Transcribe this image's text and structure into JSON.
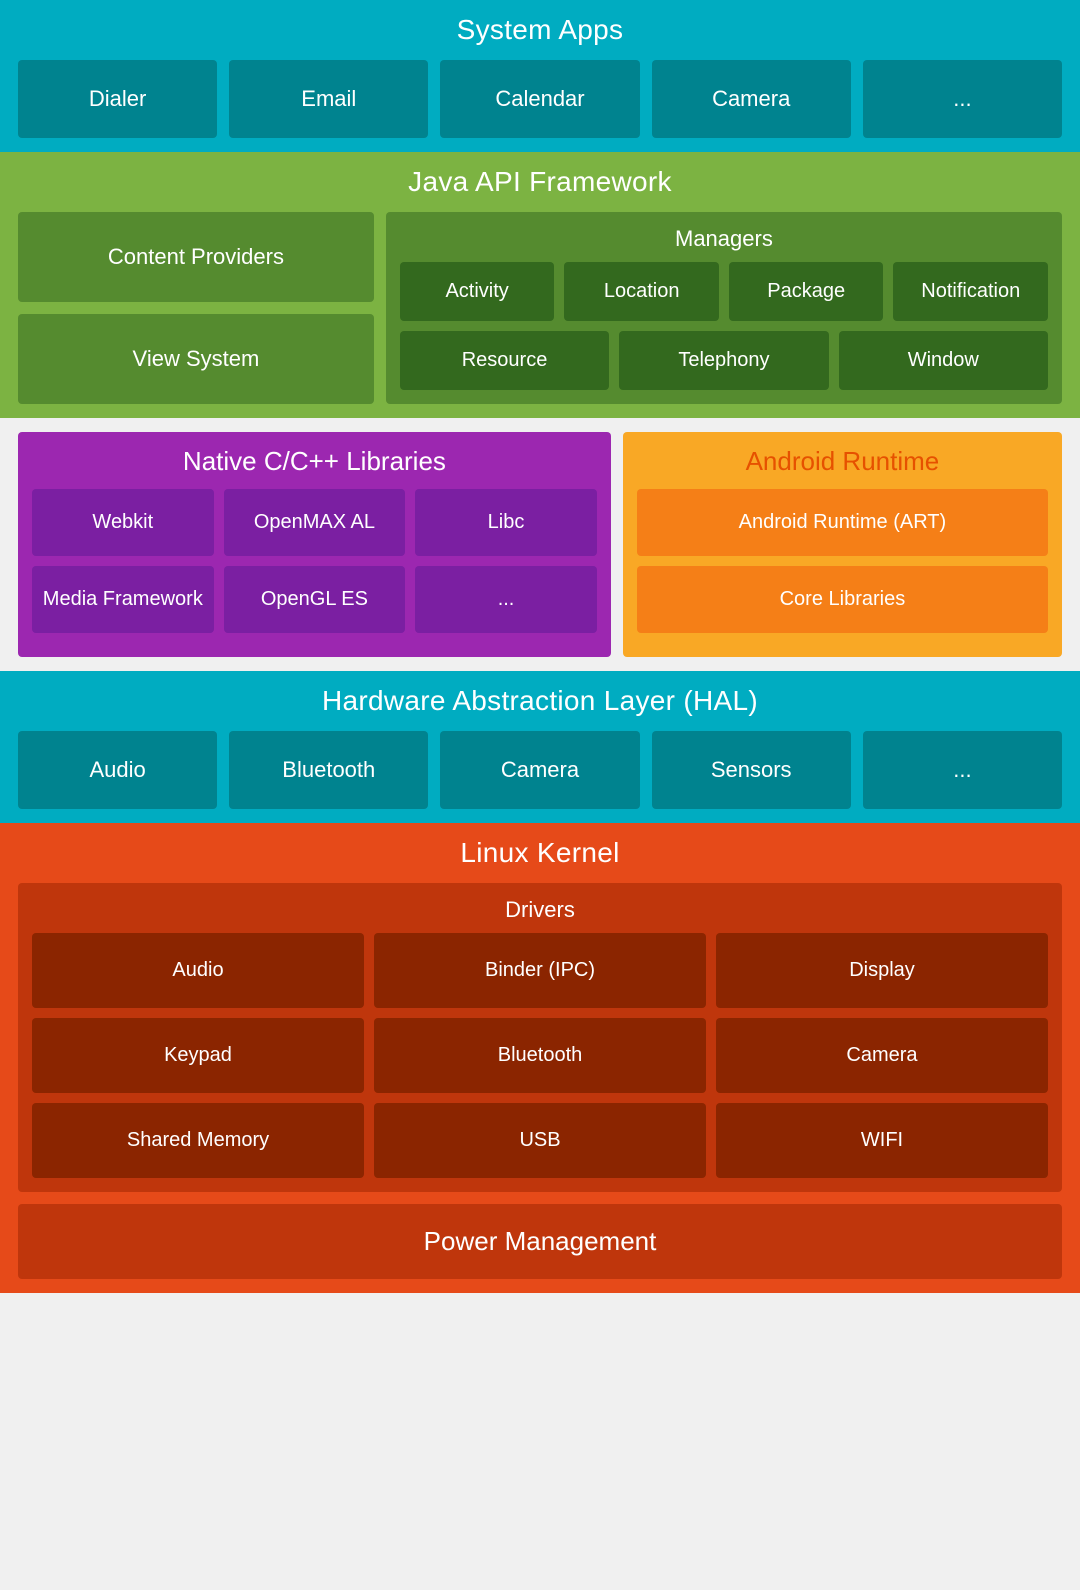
{
  "system_apps": {
    "title": "System Apps",
    "items": [
      "Dialer",
      "Email",
      "Calendar",
      "Camera",
      "..."
    ]
  },
  "java_api": {
    "title": "Java API Framework",
    "left": [
      "Content Providers",
      "View System"
    ],
    "managers": {
      "title": "Managers",
      "row1": [
        "Activity",
        "Location",
        "Package",
        "Notification"
      ],
      "row2": [
        "Resource",
        "Telephony",
        "Window"
      ]
    }
  },
  "native_libs": {
    "title": "Native C/C++ Libraries",
    "row1": [
      "Webkit",
      "OpenMAX AL",
      "Libc"
    ],
    "row2": [
      "Media Framework",
      "OpenGL ES",
      "..."
    ]
  },
  "android_runtime": {
    "title": "Android Runtime",
    "items": [
      "Android Runtime (ART)",
      "Core Libraries"
    ]
  },
  "hal": {
    "title": "Hardware Abstraction Layer (HAL)",
    "items": [
      "Audio",
      "Bluetooth",
      "Camera",
      "Sensors",
      "..."
    ]
  },
  "linux_kernel": {
    "title": "Linux Kernel",
    "drivers": {
      "title": "Drivers",
      "row1": [
        "Audio",
        "Binder (IPC)",
        "Display"
      ],
      "row2": [
        "Keypad",
        "Bluetooth",
        "Camera"
      ],
      "row3": [
        "Shared Memory",
        "USB",
        "WIFI"
      ]
    },
    "power_management": "Power Management"
  }
}
